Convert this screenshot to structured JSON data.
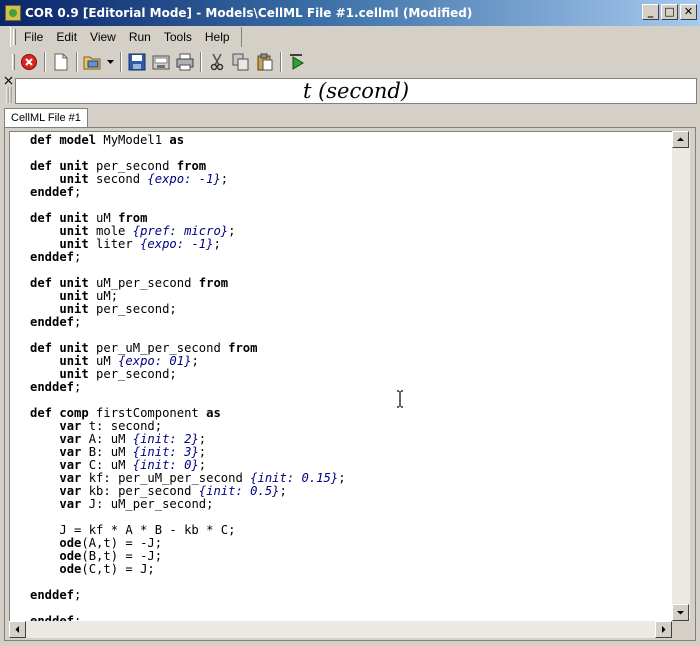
{
  "window": {
    "title": "COR 0.9 [Editorial Mode] - Models\\CellML File #1.cellml (Modified)",
    "buttons": {
      "minimize": "_",
      "maximize": "□",
      "close": "✕"
    }
  },
  "menu": {
    "items": [
      "File",
      "Edit",
      "View",
      "Run",
      "Tools",
      "Help"
    ]
  },
  "toolbar": {
    "icons": [
      "close-file-icon",
      "new-file-icon",
      "open-file-icon",
      "dropdown-arrow-icon",
      "save-icon",
      "save-all-icon",
      "print-icon",
      "cut-icon",
      "copy-icon",
      "paste-icon",
      "run-icon"
    ]
  },
  "formula": {
    "text": "t (second)"
  },
  "tab": {
    "label": "CellML File #1"
  },
  "editor": {
    "lines": [
      [
        [
          "kw",
          "def model "
        ],
        [
          "t",
          "MyModel1 "
        ],
        [
          "kw",
          "as"
        ]
      ],
      [],
      [
        [
          "kw",
          "def unit "
        ],
        [
          "t",
          "per_second "
        ],
        [
          "kw",
          "from"
        ]
      ],
      [
        [
          "t",
          "    "
        ],
        [
          "kw",
          "unit "
        ],
        [
          "t",
          "second "
        ],
        [
          "cm",
          "{expo: -1}"
        ],
        [
          "t",
          ";"
        ]
      ],
      [
        [
          "kw",
          "enddef"
        ],
        [
          "t",
          ";"
        ]
      ],
      [],
      [
        [
          "kw",
          "def unit "
        ],
        [
          "t",
          "uM "
        ],
        [
          "kw",
          "from"
        ]
      ],
      [
        [
          "t",
          "    "
        ],
        [
          "kw",
          "unit "
        ],
        [
          "t",
          "mole "
        ],
        [
          "cm",
          "{pref: micro}"
        ],
        [
          "t",
          ";"
        ]
      ],
      [
        [
          "t",
          "    "
        ],
        [
          "kw",
          "unit "
        ],
        [
          "t",
          "liter "
        ],
        [
          "cm",
          "{expo: -1}"
        ],
        [
          "t",
          ";"
        ]
      ],
      [
        [
          "kw",
          "enddef"
        ],
        [
          "t",
          ";"
        ]
      ],
      [],
      [
        [
          "kw",
          "def unit "
        ],
        [
          "t",
          "uM_per_second "
        ],
        [
          "kw",
          "from"
        ]
      ],
      [
        [
          "t",
          "    "
        ],
        [
          "kw",
          "unit "
        ],
        [
          "t",
          "uM;"
        ]
      ],
      [
        [
          "t",
          "    "
        ],
        [
          "kw",
          "unit "
        ],
        [
          "t",
          "per_second;"
        ]
      ],
      [
        [
          "kw",
          "enddef"
        ],
        [
          "t",
          ";"
        ]
      ],
      [],
      [
        [
          "kw",
          "def unit "
        ],
        [
          "t",
          "per_uM_per_second "
        ],
        [
          "kw",
          "from"
        ]
      ],
      [
        [
          "t",
          "    "
        ],
        [
          "kw",
          "unit "
        ],
        [
          "t",
          "uM "
        ],
        [
          "cm",
          "{expo: 01}"
        ],
        [
          "t",
          ";"
        ]
      ],
      [
        [
          "t",
          "    "
        ],
        [
          "kw",
          "unit "
        ],
        [
          "t",
          "per_second;"
        ]
      ],
      [
        [
          "kw",
          "enddef"
        ],
        [
          "t",
          ";"
        ]
      ],
      [],
      [
        [
          "kw",
          "def comp "
        ],
        [
          "t",
          "firstComponent "
        ],
        [
          "kw",
          "as"
        ]
      ],
      [
        [
          "t",
          "    "
        ],
        [
          "kw",
          "var "
        ],
        [
          "t",
          "t: second;"
        ]
      ],
      [
        [
          "t",
          "    "
        ],
        [
          "kw",
          "var "
        ],
        [
          "t",
          "A: uM "
        ],
        [
          "cm",
          "{init: 2}"
        ],
        [
          "t",
          ";"
        ]
      ],
      [
        [
          "t",
          "    "
        ],
        [
          "kw",
          "var "
        ],
        [
          "t",
          "B: uM "
        ],
        [
          "cm",
          "{init: 3}"
        ],
        [
          "t",
          ";"
        ]
      ],
      [
        [
          "t",
          "    "
        ],
        [
          "kw",
          "var "
        ],
        [
          "t",
          "C: uM "
        ],
        [
          "cm",
          "{init: 0}"
        ],
        [
          "t",
          ";"
        ]
      ],
      [
        [
          "t",
          "    "
        ],
        [
          "kw",
          "var "
        ],
        [
          "t",
          "kf: per_uM_per_second "
        ],
        [
          "cm",
          "{init: 0.15}"
        ],
        [
          "t",
          ";"
        ]
      ],
      [
        [
          "t",
          "    "
        ],
        [
          "kw",
          "var "
        ],
        [
          "t",
          "kb: per_second "
        ],
        [
          "cm",
          "{init: 0.5}"
        ],
        [
          "t",
          ";"
        ]
      ],
      [
        [
          "t",
          "    "
        ],
        [
          "kw",
          "var "
        ],
        [
          "t",
          "J: uM_per_second;"
        ]
      ],
      [],
      [
        [
          "t",
          "    J = kf * A * B - kb * C;"
        ]
      ],
      [
        [
          "t",
          "    "
        ],
        [
          "kw",
          "ode"
        ],
        [
          "t",
          "(A,t) = -J;"
        ]
      ],
      [
        [
          "t",
          "    "
        ],
        [
          "kw",
          "ode"
        ],
        [
          "t",
          "(B,t) = -J;"
        ]
      ],
      [
        [
          "t",
          "    "
        ],
        [
          "kw",
          "ode"
        ],
        [
          "t",
          "(C,t) = J;"
        ]
      ],
      [],
      [
        [
          "kw",
          "enddef"
        ],
        [
          "t",
          ";"
        ]
      ],
      [],
      [
        [
          "kw",
          "enddef"
        ],
        [
          "t",
          ";"
        ]
      ]
    ]
  },
  "colors": {
    "titlebar_start": "#0a246a",
    "titlebar_end": "#a6caf0",
    "comment": "#000080",
    "chrome": "#d4d0c8"
  }
}
